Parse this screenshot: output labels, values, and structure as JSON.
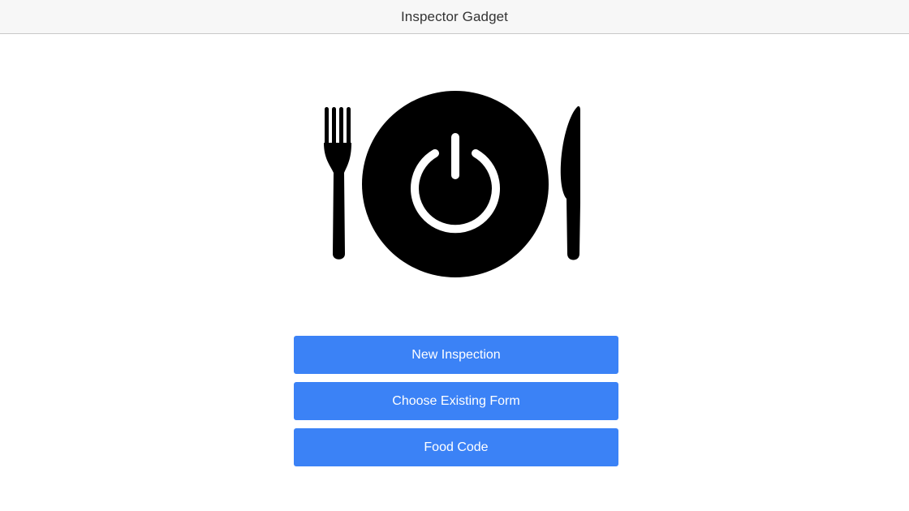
{
  "window": {
    "title": "Inspector Gadget"
  },
  "logo": {
    "icon": "plate-power-icon",
    "color": "#000000"
  },
  "actions": [
    {
      "label": "New Inspection"
    },
    {
      "label": "Choose Existing Form"
    },
    {
      "label": "Food Code"
    }
  ],
  "theme": {
    "button_color": "#3b82f6",
    "button_text_color": "#ffffff",
    "title_bar_color": "#f7f7f7"
  }
}
